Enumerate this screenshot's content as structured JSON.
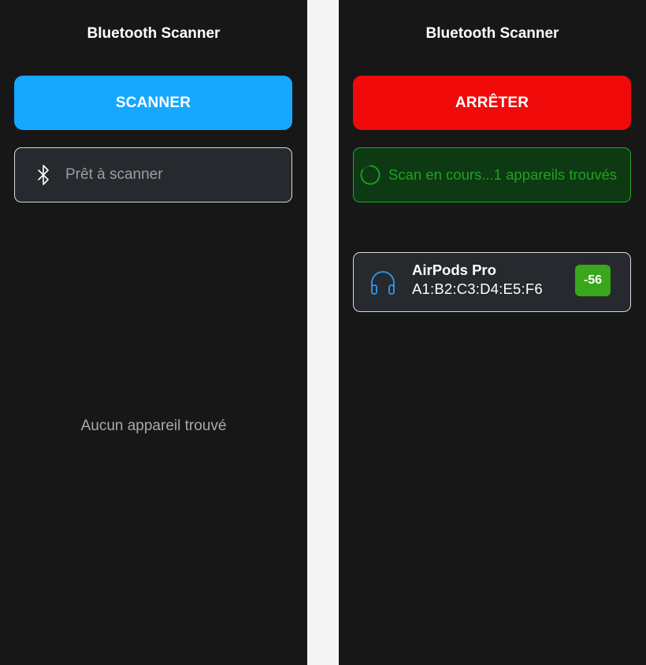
{
  "left_screen": {
    "title": "Bluetooth Scanner",
    "scan_button_label": "SCANNER",
    "status": {
      "icon": "bluetooth-icon",
      "text": "Prêt à scanner"
    },
    "empty_message": "Aucun appareil trouvé"
  },
  "right_screen": {
    "title": "Bluetooth Scanner",
    "stop_button_label": "ARRÊTER",
    "status": {
      "icon": "spinner-icon",
      "text": "Scan en cours...1 appareils trouvés"
    },
    "devices": [
      {
        "icon": "headphones-icon",
        "name": "AirPods Pro",
        "mac": "A1:B2:C3:D4:E5:F6",
        "rssi": "-56"
      }
    ]
  },
  "colors": {
    "background": "#171718",
    "scan_button": "#16a7ff",
    "stop_button": "#f00a0a",
    "status_active_text": "#22a022",
    "rssi_badge": "#3aa61b",
    "device_icon": "#2e9bf0"
  }
}
